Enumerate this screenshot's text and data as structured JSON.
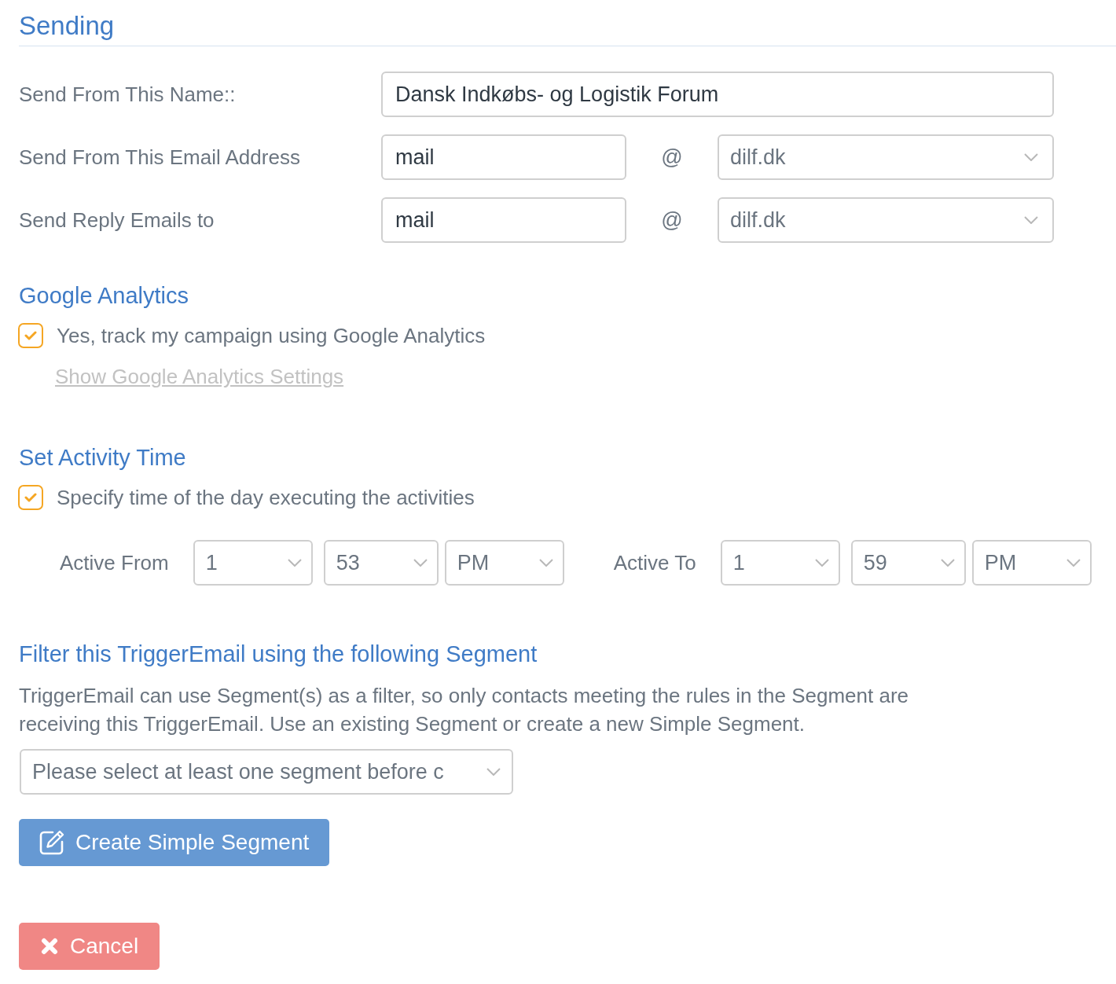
{
  "sending": {
    "title": "Sending",
    "fields": [
      {
        "kind": "text",
        "label": "Send From This Name::",
        "value": "Dansk Indkøbs- og Logistik Forum"
      },
      {
        "kind": "email",
        "label": "Send From This Email Address",
        "local": "mail",
        "at": "@",
        "domain": "dilf.dk"
      },
      {
        "kind": "email",
        "label": "Send Reply Emails to",
        "local": "mail",
        "at": "@",
        "domain": "dilf.dk"
      }
    ]
  },
  "google_analytics": {
    "title": "Google Analytics",
    "checkbox": {
      "label": "Yes, track my campaign using Google Analytics",
      "checked": true
    },
    "link": "Show Google Analytics Settings"
  },
  "activity_time": {
    "title": "Set Activity Time",
    "checkbox": {
      "label": "Specify time of the day executing the activities",
      "checked": true
    },
    "ranges": [
      {
        "label": "Active From",
        "hour": "1",
        "minute": "53",
        "period": "PM"
      },
      {
        "label": "Active To",
        "hour": "1",
        "minute": "59",
        "period": "PM"
      }
    ]
  },
  "segment_filter": {
    "title": "Filter this TriggerEmail using the following Segment",
    "description": "TriggerEmail can use Segment(s) as a filter, so only contacts meeting the rules in the Segment are receiving this TriggerEmail. Use an existing Segment or create a new Simple Segment.",
    "select": {
      "value": "Please select at least one segment before c"
    },
    "create_button": "Create Simple Segment"
  },
  "cancel_button": "Cancel"
}
